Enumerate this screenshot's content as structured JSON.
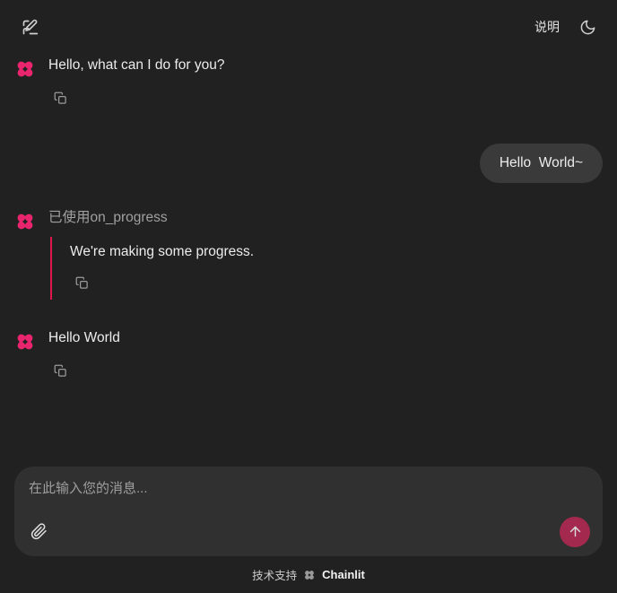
{
  "app": {
    "background_color": "#212121",
    "accent_color": "#e0174f",
    "send_button_color": "#a32a4e"
  },
  "header": {
    "new_chat_icon": "new-chat-pencil-square-icon",
    "readme_label": "说明",
    "theme_icon": "moon-icon"
  },
  "conversation": {
    "messages": [
      {
        "role": "assistant",
        "avatar_icon": "chainlit-logo-icon",
        "text": "Hello, what can I do for you?",
        "copy_icon": "copy-icon"
      },
      {
        "role": "user",
        "text": "Hello  World~"
      },
      {
        "role": "assistant",
        "avatar_icon": "chainlit-logo-icon",
        "step_label": "已使用on_progress",
        "nested_text": "We're making some progress.",
        "copy_icon": "copy-icon"
      },
      {
        "role": "assistant",
        "avatar_icon": "chainlit-logo-icon",
        "text": "Hello World",
        "copy_icon": "copy-icon"
      }
    ]
  },
  "composer": {
    "placeholder": "在此输入您的消息...",
    "value": "",
    "attach_icon": "paperclip-icon",
    "send_icon": "arrow-up-icon"
  },
  "footer": {
    "prefix": "技术支持",
    "logo_icon": "chainlit-logo-icon",
    "brand": "Chainlit"
  }
}
